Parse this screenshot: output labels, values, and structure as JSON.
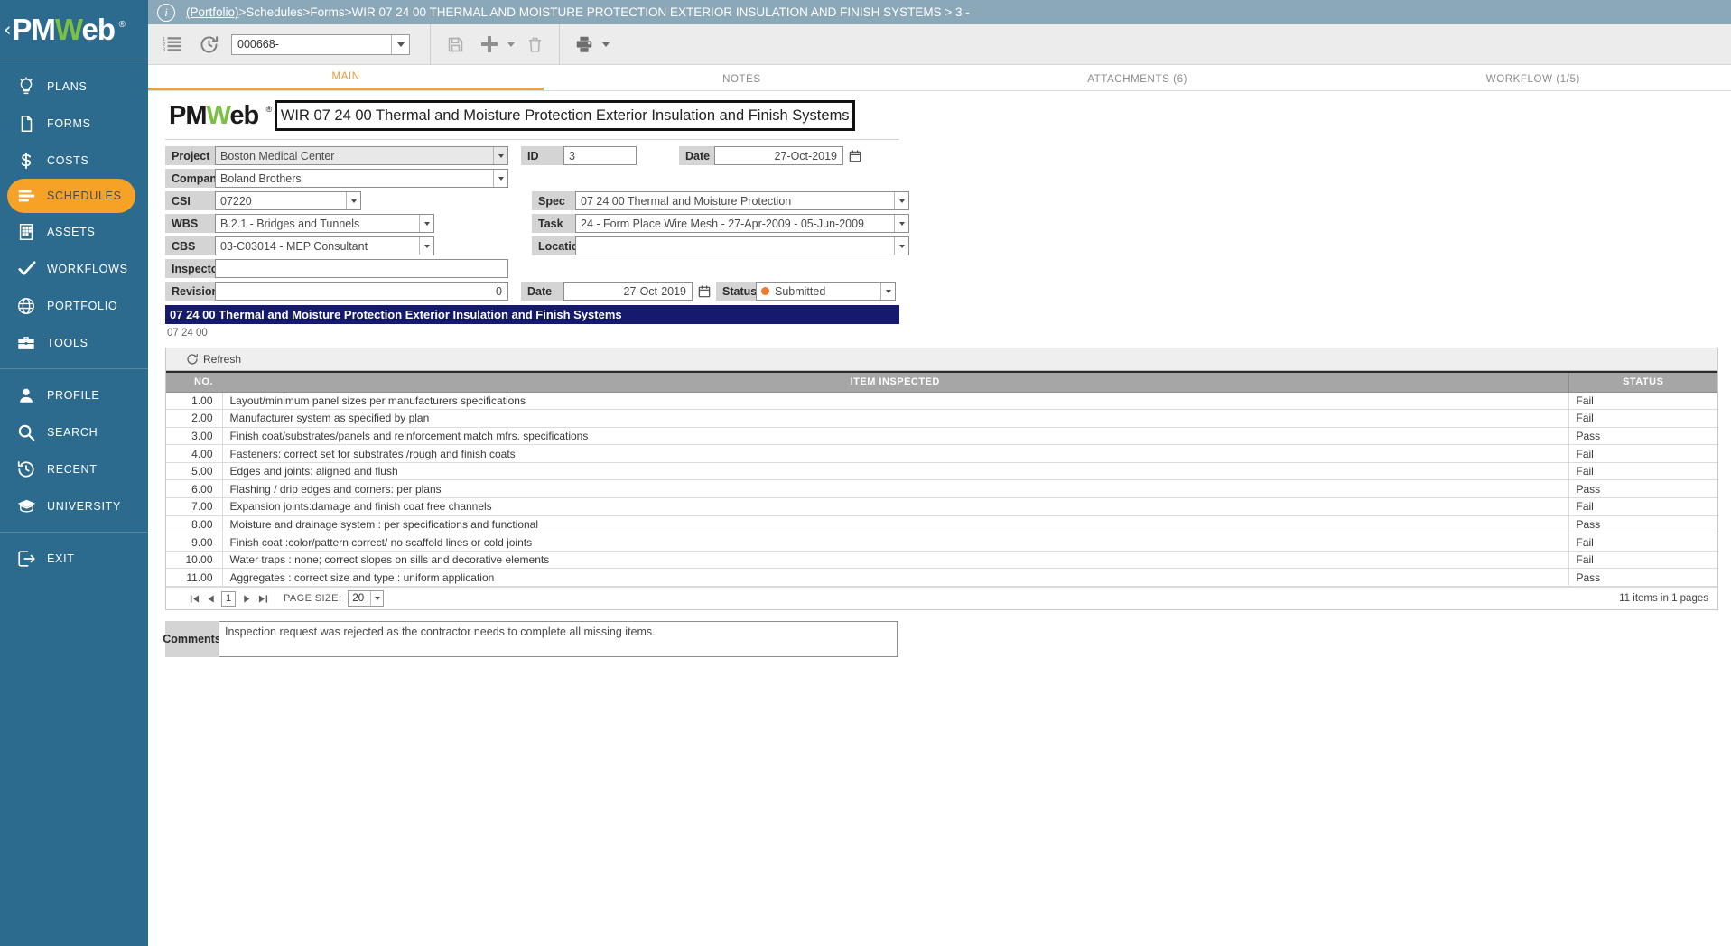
{
  "sidebar": {
    "logo": {
      "part1": "PM",
      "part2": "W",
      "part3": "eb",
      "reg": "®",
      "collapse": "‹"
    },
    "items": [
      {
        "label": "PLANS",
        "icon": "lightbulb-icon",
        "active": false
      },
      {
        "label": "FORMS",
        "icon": "document-icon",
        "active": false
      },
      {
        "label": "COSTS",
        "icon": "dollar-icon",
        "active": false
      },
      {
        "label": "SCHEDULES",
        "icon": "bars-icon",
        "active": true
      },
      {
        "label": "ASSETS",
        "icon": "building-icon",
        "active": false
      },
      {
        "label": "WORKFLOWS",
        "icon": "check-icon",
        "active": false
      },
      {
        "label": "PORTFOLIO",
        "icon": "globe-icon",
        "active": false
      },
      {
        "label": "TOOLS",
        "icon": "briefcase-icon",
        "active": false
      }
    ],
    "items2": [
      {
        "label": "PROFILE",
        "icon": "user-icon"
      },
      {
        "label": "SEARCH",
        "icon": "search-icon"
      },
      {
        "label": "RECENT",
        "icon": "history-icon"
      },
      {
        "label": "UNIVERSITY",
        "icon": "graduation-cap-icon"
      }
    ],
    "items3": [
      {
        "label": "EXIT",
        "icon": "exit-icon"
      }
    ]
  },
  "breadcrumb": {
    "root": "(Portfolio)",
    "sep1": " > ",
    "l2": "Schedules",
    "sep2": " > ",
    "l3": "Forms",
    "sep3": " > ",
    "l4": "WIR 07 24 00 THERMAL AND MOISTURE PROTECTION EXTERIOR INSULATION AND FINISH SYSTEMS > 3 -"
  },
  "toolbar": {
    "list_icon": "numbered-list-icon",
    "history_icon": "history-icon",
    "doc_number": "000668-",
    "save_icon": "save-icon",
    "add_icon": "plus-icon",
    "delete_icon": "trash-icon",
    "print_icon": "printer-icon"
  },
  "tabs": [
    {
      "label": "MAIN",
      "active": true
    },
    {
      "label": "NOTES",
      "active": false
    },
    {
      "label": "ATTACHMENTS (6)",
      "active": false
    },
    {
      "label": "WORKFLOW (1/5)",
      "active": false
    }
  ],
  "form": {
    "brand": {
      "part1": "PM",
      "part2": "W",
      "part3": "eb",
      "reg": "®"
    },
    "title": "WIR 07 24 00 Thermal and Moisture Protection Exterior Insulation and Finish Systems",
    "project_label": "Project",
    "project_value": "Boston Medical Center",
    "company_label": "Company",
    "company_value": "Boland Brothers",
    "csi_label": "CSI",
    "csi_value": "07220",
    "wbs_label": "WBS",
    "wbs_value": "B.2.1 - Bridges and Tunnels",
    "cbs_label": "CBS",
    "cbs_value": "03-C03014 - MEP Consultant",
    "inspector_label": "Inspector",
    "inspector_value": "",
    "revision_label": "Revision",
    "revision_value": "0",
    "id_label": "ID",
    "id_value": "3",
    "date_label": "Date",
    "date_value": "27-Oct-2019",
    "spec_label": "Spec",
    "spec_value": "07 24 00 Thermal and Moisture Protection",
    "task_label": "Task",
    "task_value": "24 - Form Place Wire Mesh - 27-Apr-2009 - 05-Jun-2009",
    "location_label": "Location",
    "location_value": "",
    "date2_label": "Date",
    "date2_value": "27-Oct-2019",
    "status_label": "Status",
    "status_value": "Submitted",
    "status_color": "#f07c2b",
    "section_band": "07 24 00 Thermal and Moisture Protection Exterior Insulation and Finish Systems",
    "section_band_color": "#151a6e",
    "sub_code": "07 24 00"
  },
  "grid": {
    "refresh_label": "Refresh",
    "columns": [
      "NO.",
      "ITEM INSPECTED",
      "STATUS"
    ],
    "rows": [
      {
        "no": "1.00",
        "item": "Layout/minimum panel sizes per manufacturers specifications",
        "status": "Fail"
      },
      {
        "no": "2.00",
        "item": "Manufacturer system as specified by plan",
        "status": "Fail"
      },
      {
        "no": "3.00",
        "item": "Finish coat/substrates/panels and reinforcement match mfrs. specifications",
        "status": "Pass"
      },
      {
        "no": "4.00",
        "item": "Fasteners: correct set for substrates /rough and finish coats",
        "status": "Fail"
      },
      {
        "no": "5.00",
        "item": "Edges and joints: aligned and flush",
        "status": "Fail"
      },
      {
        "no": "6.00",
        "item": "Flashing / drip edges and corners: per plans",
        "status": "Pass"
      },
      {
        "no": "7.00",
        "item": "Expansion joints:damage and finish coat free channels",
        "status": "Fail"
      },
      {
        "no": "8.00",
        "item": "Moisture and drainage system : per specifications and functional",
        "status": "Pass"
      },
      {
        "no": "9.00",
        "item": "Finish coat :color/pattern correct/ no scaffold lines or cold joints",
        "status": "Fail"
      },
      {
        "no": "10.00",
        "item": "Water traps : none; correct slopes on sills and decorative elements",
        "status": "Fail"
      },
      {
        "no": "11.00",
        "item": "Aggregates : correct size and type : uniform application",
        "status": "Pass"
      }
    ],
    "pager": {
      "current_page": "1",
      "page_size_label": "PAGE SIZE:",
      "page_size": "20",
      "summary": "11 items in 1 pages"
    }
  },
  "comments": {
    "label": "Comments",
    "value": "Inspection request was rejected as the contractor needs to complete all missing items."
  }
}
